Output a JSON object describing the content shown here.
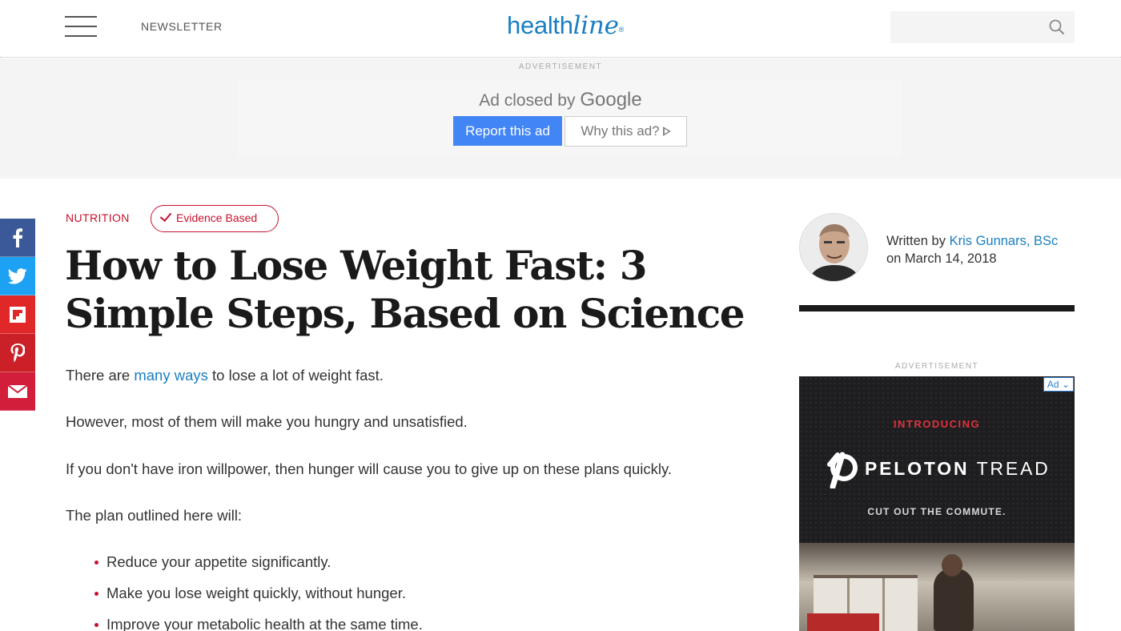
{
  "header": {
    "newsletter": "NEWSLETTER",
    "logo_health": "health",
    "logo_line": "line",
    "logo_mark": "®"
  },
  "top_ad": {
    "label": "ADVERTISEMENT",
    "closed_text": "Ad closed by",
    "closed_brand": "Google",
    "report": "Report this ad",
    "why": "Why this ad?"
  },
  "social": [
    "facebook-icon",
    "twitter-icon",
    "flipboard-icon",
    "pinterest-icon",
    "email-icon"
  ],
  "article": {
    "category": "NUTRITION",
    "badge": "Evidence Based",
    "title": "How to Lose Weight Fast: 3 Simple Steps, Based on Science",
    "p1_before": "There are ",
    "p1_link": "many ways",
    "p1_after": " to lose a lot of weight fast.",
    "p2": "However, most of them will make you hungry and unsatisfied.",
    "p3": "If you don't have iron willpower, then hunger will cause you to give up on these plans quickly.",
    "p4": "The plan outlined here will:",
    "bullets": [
      "Reduce your appetite significantly.",
      "Make you lose weight quickly, without hunger.",
      "Improve your metabolic health at the same time."
    ]
  },
  "author": {
    "written_by": "Written by",
    "name": "Kris Gunnars, BSc",
    "date": "on March 14, 2018"
  },
  "side_ad": {
    "label": "ADVERTISEMENT",
    "badge": "Ad",
    "introducing": "INTRODUCING",
    "brand": "PELOTON",
    "product": "TREAD",
    "tagline": "CUT OUT THE COMMUTE."
  },
  "colors": {
    "brand_blue": "#1a7fc1",
    "accent_red": "#c8102e",
    "google_blue": "#4285f4"
  }
}
